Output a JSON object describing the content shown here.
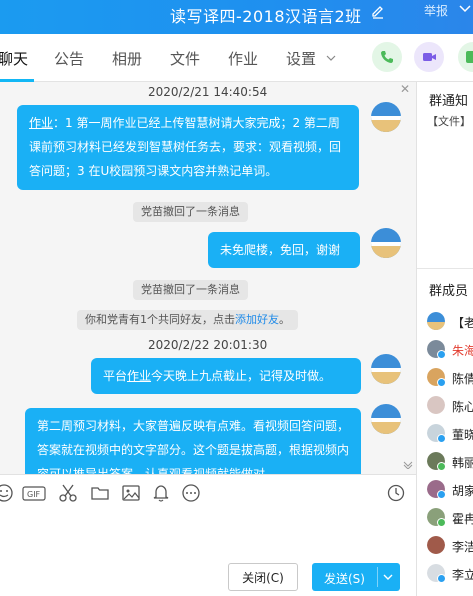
{
  "header": {
    "title": "读写译四-2018汉语言2班",
    "report_label": "举报"
  },
  "tabs": [
    {
      "label": "聊天"
    },
    {
      "label": "公告"
    },
    {
      "label": "相册"
    },
    {
      "label": "文件"
    },
    {
      "label": "作业"
    },
    {
      "label": "设置"
    }
  ],
  "actions": {
    "call_color": "#4cba5a",
    "video_color": "#7b5ce6",
    "tool_color": "#4cba5a"
  },
  "messages": {
    "ts1": "2020/2/21 14:40:54",
    "msg1_prefix": "作业",
    "msg1_body": "：1 第一周作业已经上传智慧树请大家完成；2 第二周课前预习材料已经发到智慧树任务去，要求：观看视频，回答问题；3 在U校园预习课文内容并熟记单词。",
    "sys1": "党苗撤回了一条消息",
    "msg2": "未免爬楼，免回，谢谢",
    "sys2": "党苗撤回了一条消息",
    "sys3_text": "你和党青有1个共同好友，点击",
    "sys3_link": "添加好友",
    "sys3_end": "。",
    "ts2": "2020/2/22 20:01:30",
    "msg3_a": "平台",
    "msg3_b": "作业",
    "msg3_c": "今天晚上九点截止，记得及时做。",
    "msg4": "第二周预习材料，大家普遍反映有点难。看视频回答问题，答案就在视频中的文字部分。这个题是拔高题，根据视频内容可以推导出答案，认真观看视频就能做对。"
  },
  "composer": {
    "close_label": "关闭(C)",
    "send_label": "发送(S)"
  },
  "sidebar": {
    "notice_title": "群通知",
    "notice_item": "【文件】",
    "members_title": "群成员",
    "members": [
      {
        "name": "【老"
      },
      {
        "name": "朱海"
      },
      {
        "name": "陈倩"
      },
      {
        "name": "陈心"
      },
      {
        "name": "董晓"
      },
      {
        "name": "韩丽"
      },
      {
        "name": "胡家"
      },
      {
        "name": "霍冉"
      },
      {
        "name": "李洁"
      },
      {
        "name": "李立"
      }
    ]
  }
}
